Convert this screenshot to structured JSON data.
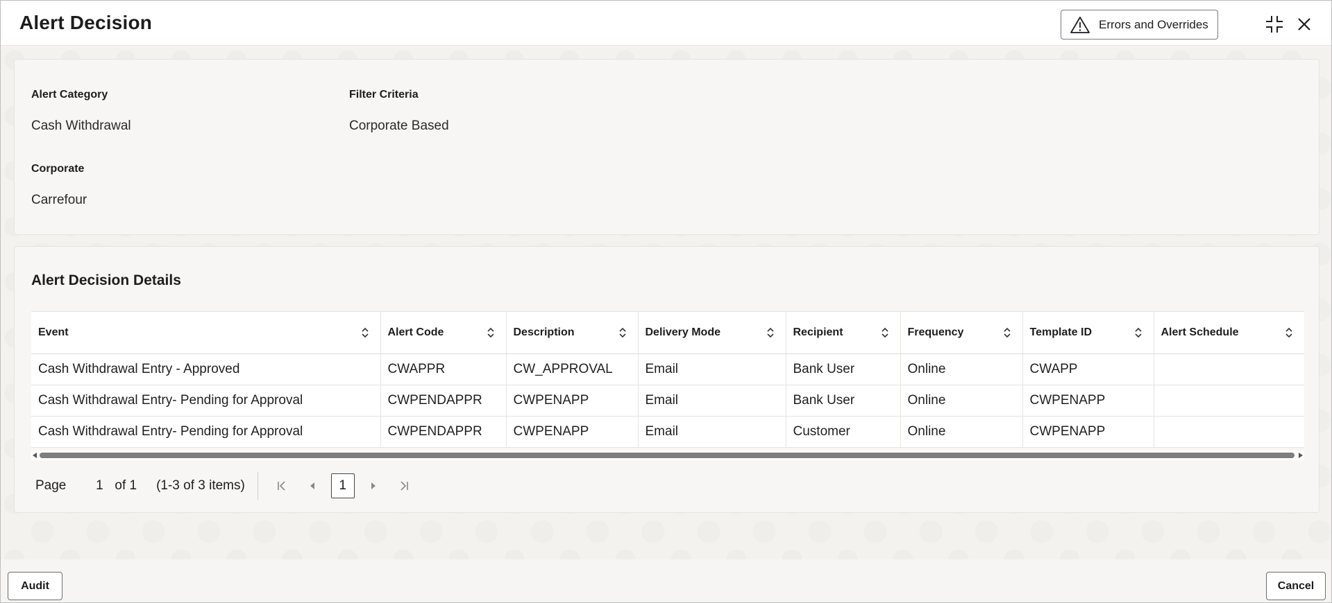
{
  "header": {
    "title": "Alert Decision",
    "errors_button_label": "Errors and Overrides"
  },
  "summary": {
    "alert_category_label": "Alert Category",
    "alert_category_value": "Cash Withdrawal",
    "filter_criteria_label": "Filter Criteria",
    "filter_criteria_value": "Corporate Based",
    "corporate_label": "Corporate",
    "corporate_value": "Carrefour"
  },
  "details": {
    "section_title": "Alert Decision Details",
    "columns": [
      "Event",
      "Alert Code",
      "Description",
      "Delivery Mode",
      "Recipient",
      "Frequency",
      "Template ID",
      "Alert Schedule"
    ],
    "rows": [
      [
        "Cash Withdrawal Entry - Approved",
        "CWAPPR",
        "CW_APPROVAL",
        "Email",
        "Bank User",
        "Online",
        "CWAPP",
        ""
      ],
      [
        "Cash Withdrawal Entry- Pending for Approval",
        "CWPENDAPPR",
        "CWPENAPP",
        "Email",
        "Bank User",
        "Online",
        "CWPENAPP",
        ""
      ],
      [
        "Cash Withdrawal Entry- Pending for Approval",
        "CWPENDAPPR",
        "CWPENAPP",
        "Email",
        "Customer",
        "Online",
        "CWPENAPP",
        ""
      ]
    ]
  },
  "pagination": {
    "page_label": "Page",
    "current_page": "1",
    "of_label": "of 1",
    "items_label": "(1-3 of 3 items)",
    "page_button": "1"
  },
  "footer": {
    "audit_label": "Audit",
    "cancel_label": "Cancel"
  }
}
